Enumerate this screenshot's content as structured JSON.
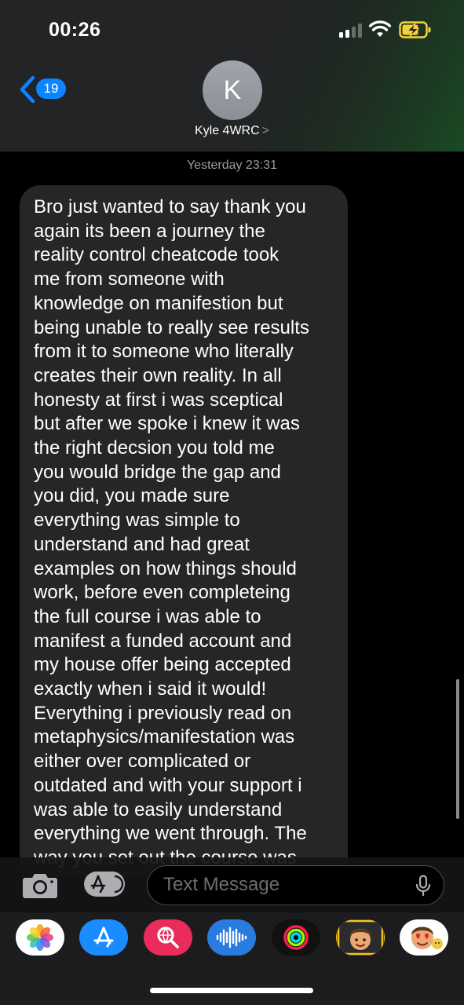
{
  "status_bar": {
    "time": "00:26"
  },
  "header": {
    "back_count": "19",
    "avatar_initial": "K",
    "contact_name": "Kyle 4WRC",
    "contact_chevron": ">"
  },
  "conversation": {
    "timestamp": "Yesterday 23:31",
    "messages": [
      {
        "direction": "incoming",
        "text": "Bro just wanted to say thank you\nagain its been a journey the\nreality control cheatcode took\nme from someone with\nknowledge on manifestion but\nbeing unable to really see results\nfrom it to someone who  literally\ncreates their own reality. In all\nhonesty at first i was sceptical\nbut after we spoke i knew it was\nthe right decsion you told me\nyou would bridge the gap and\nyou did, you made sure\neverything was simple to\nunderstand and had great\nexamples on how things should\nwork, before even completeing\nthe full course i was able to\nmanifest a funded account and\nmy house offer being accepted\nexactly when i said it would!\nEverything i previously read on\nmetaphysics/manifestation was\neither over complicated or\noutdated and with your support i\nwas able to easily understand\neverything we went through. The\nway you set out the course was"
      }
    ]
  },
  "composer": {
    "placeholder": "Text Message"
  },
  "app_drawer": {
    "apps": [
      {
        "name": "photos",
        "icon": "photos-icon",
        "color": "#ffffff"
      },
      {
        "name": "app-store",
        "icon": "app-store-icon",
        "color": "#1a8cff"
      },
      {
        "name": "search-images",
        "icon": "image-search-icon",
        "color": "#ea2c5d"
      },
      {
        "name": "audio-message",
        "icon": "audio-waveform-icon",
        "color": "#2a7be0"
      },
      {
        "name": "activity",
        "icon": "activity-rings-icon",
        "color": "#111111"
      },
      {
        "name": "memoji",
        "icon": "memoji-icon",
        "color": "#f5c518"
      },
      {
        "name": "memoji-stickers",
        "icon": "memoji-stickers-icon",
        "color": "#ffffff"
      }
    ]
  },
  "colors": {
    "accent": "#0a84ff",
    "bubble_incoming": "#262628",
    "background": "#000000"
  }
}
